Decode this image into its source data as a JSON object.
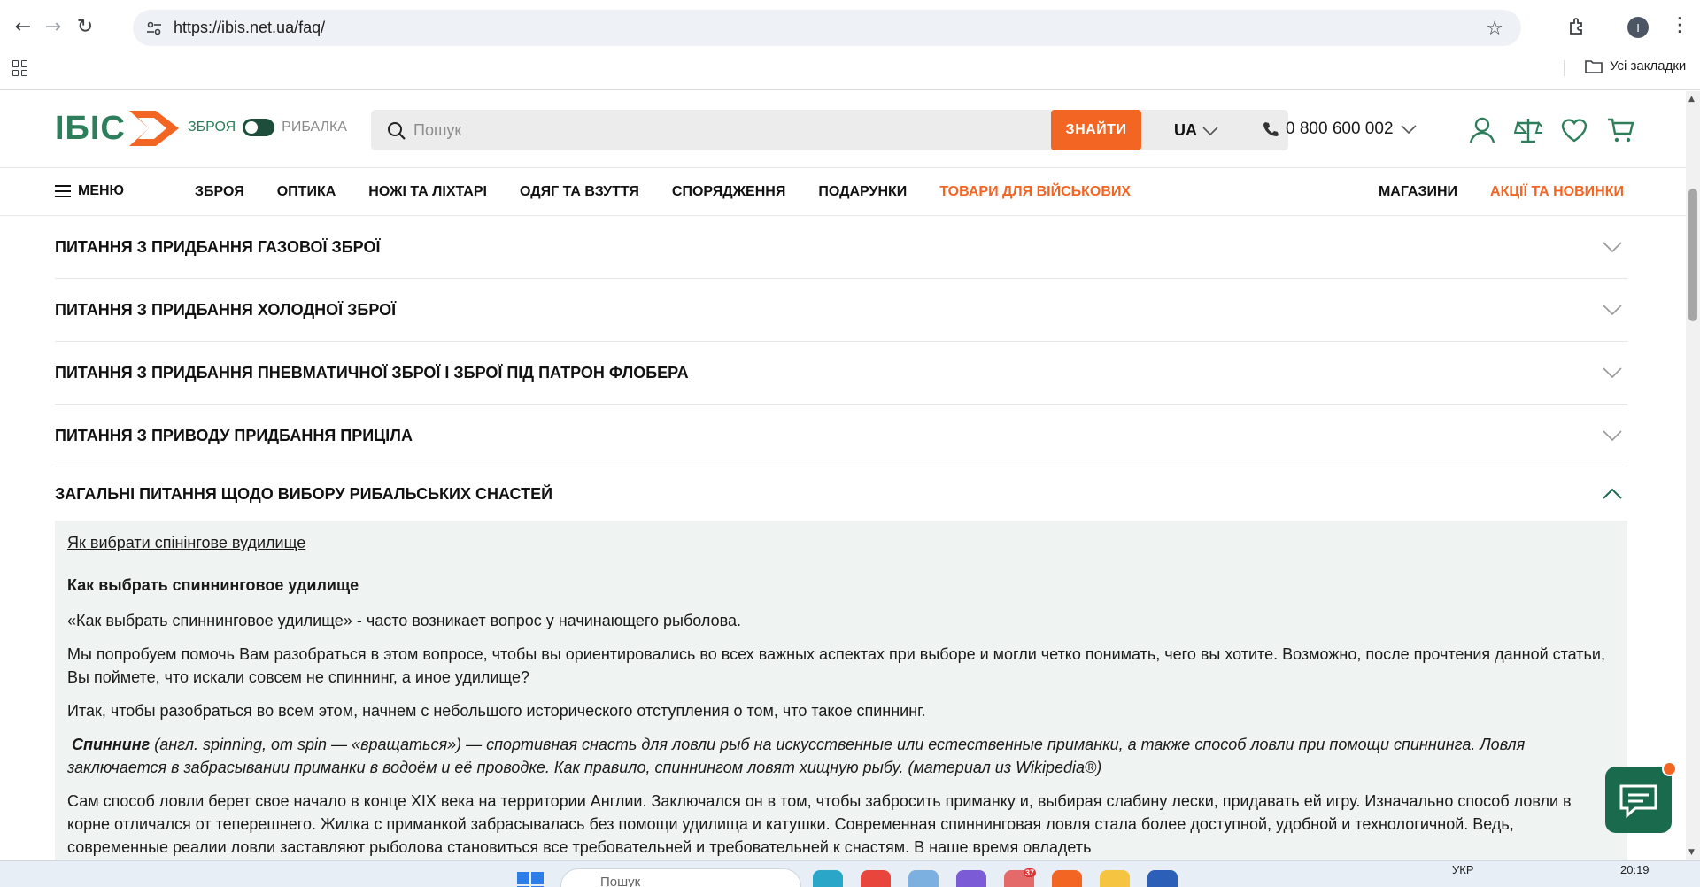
{
  "browser": {
    "url": "https://ibis.net.ua/faq/",
    "bookmarks_label": "Усі закладки",
    "profile_initial": "I"
  },
  "header": {
    "logo_text": "ІБІС",
    "switch_left": "ЗБРОЯ",
    "switch_right": "РИБАЛКА",
    "search_placeholder": "Пошук",
    "search_button": "ЗНАЙТИ",
    "language": "UA",
    "phone": "0 800 600 002",
    "accent_color": "#f26523",
    "brand_color": "#2e7d5b"
  },
  "nav": {
    "menu_label": "МЕНЮ",
    "categories": [
      "ЗБРОЯ",
      "ОПТИКА",
      "НОЖІ ТА ЛІХТАРІ",
      "ОДЯГ ТА ВЗУТТЯ",
      "СПОРЯДЖЕННЯ",
      "ПОДАРУНКИ"
    ],
    "military": "ТОВАРИ ДЛЯ ВІЙСЬКОВИХ",
    "stores": "МАГАЗИНИ",
    "promo": "АКЦІЇ ТА НОВИНКИ"
  },
  "faq": {
    "collapsed": [
      "ПИТАННЯ З ПРИДБАННЯ ГАЗОВОЇ ЗБРОЇ",
      "ПИТАННЯ З ПРИДБАННЯ ХОЛОДНОЇ ЗБРОЇ",
      "ПИТАННЯ З ПРИДБАННЯ ПНЕВМАТИЧНОЇ ЗБРОЇ І ЗБРОЇ ПІД ПАТРОН ФЛОБЕРА",
      "ПИТАННЯ З ПРИВОДУ ПРИДБАННЯ ПРИЦІЛА"
    ],
    "open_title": "ЗАГАЛЬНІ ПИТАННЯ ЩОДО ВИБОРУ РИБАЛЬСЬКИХ СНАСТЕЙ",
    "answer": {
      "link": "Як вибрати спінінгове вудилище",
      "heading": "Как выбрать спиннинговое удилище",
      "p1": "«Как выбрать спиннинговое удилище» - часто возникает вопрос у начинающего рыболова.",
      "p2": "Мы попробуем помочь Вам разобраться в этом вопросе, чтобы вы ориентировались во всех важных аспектах при выборе и могли четко понимать, чего вы хотите. Возможно, после прочтения данной статьи, Вы поймете, что искали совсем не спиннинг, а иное удилище?",
      "p3": " Итак, чтобы разобраться во всем этом, начнем с небольшого исторического отступления о том, что такое спиннинг.",
      "p4_bold": "Спиннинг",
      "p4_rest": " (англ. spinning, от spin — «вращаться») — спортивная снасть для ловли рыб на искусственные или естественные приманки, а также способ ловли при помощи спиннинга. Ловля заключается в забрасывании приманки в водоём и её проводке. Как правило, спиннингом ловят хищную рыбу. (материал из Wikipedia®)",
      "p5": "Сам способ ловли берет свое начало в конце XIX века на территории Англии. Заключался он в том, чтобы забросить приманку и, выбирая слабину лески, придавать ей игру. Изначально способ ловли в корне отличался от теперешнего. Жилка с приманкой забрасывалась без помощи удилища и катушки. Современная спиннинговая ловля стала более доступной, удобной и технологичной. Ведь, современные реалии ловли заставляют рыболова становиться все требовательней и требовательней к снастям. В наше время овладеть"
    }
  },
  "taskbar": {
    "search_placeholder": "Пошук",
    "lang": "УКР",
    "time": "20:19",
    "badge": "37"
  }
}
